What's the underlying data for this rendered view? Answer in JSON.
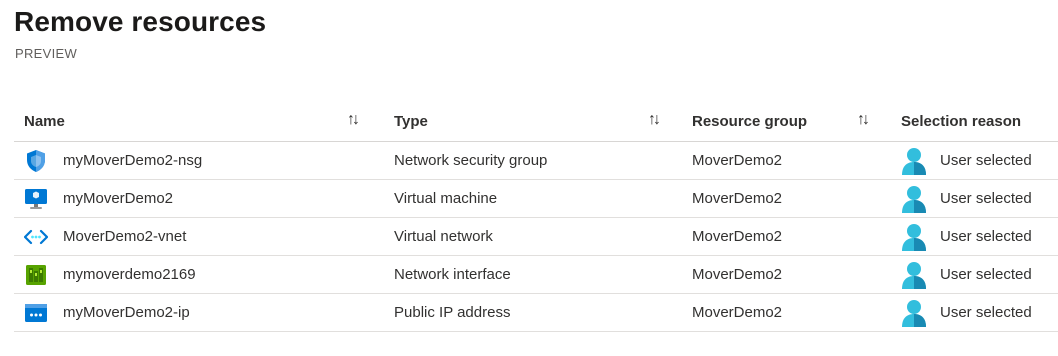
{
  "page": {
    "title": "Remove resources",
    "subtitle": "PREVIEW"
  },
  "table": {
    "columns": {
      "name": "Name",
      "type": "Type",
      "resource_group": "Resource group",
      "selection_reason": "Selection reason"
    },
    "sort_glyph": "↑↓",
    "rows": [
      {
        "icon": "network-security-group-icon",
        "name": "myMoverDemo2-nsg",
        "type": "Network security group",
        "resource_group": "MoverDemo2",
        "reason_icon": "user-icon",
        "reason": "User selected"
      },
      {
        "icon": "virtual-machine-icon",
        "name": "myMoverDemo2",
        "type": "Virtual machine",
        "resource_group": "MoverDemo2",
        "reason_icon": "user-icon",
        "reason": "User selected"
      },
      {
        "icon": "virtual-network-icon",
        "name": "MoverDemo2-vnet",
        "type": "Virtual network",
        "resource_group": "MoverDemo2",
        "reason_icon": "user-icon",
        "reason": "User selected"
      },
      {
        "icon": "network-interface-icon",
        "name": "mymoverdemo2169",
        "type": "Network interface",
        "resource_group": "MoverDemo2",
        "reason_icon": "user-icon",
        "reason": "User selected"
      },
      {
        "icon": "public-ip-address-icon",
        "name": "myMoverDemo2-ip",
        "type": "Public IP address",
        "resource_group": "MoverDemo2",
        "reason_icon": "user-icon",
        "reason": "User selected"
      }
    ]
  },
  "colors": {
    "azure_blue": "#0078d4",
    "user_icon_light": "#32bedd",
    "user_icon_dark": "#198ab3",
    "nic_green": "#57a300",
    "border": "#e1dfdd"
  }
}
